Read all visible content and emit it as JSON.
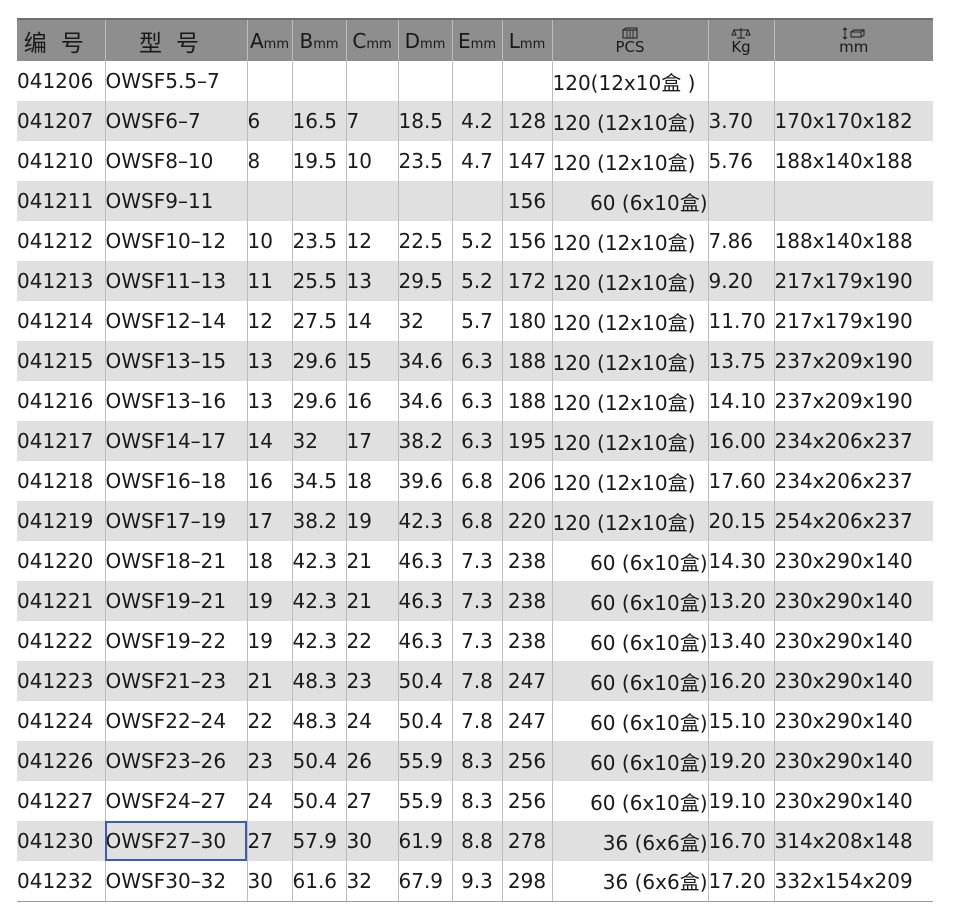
{
  "header": {
    "code": "编号",
    "model": "型号",
    "a": {
      "letter": "A",
      "unit": "mm"
    },
    "b": {
      "letter": "B",
      "unit": "mm"
    },
    "c": {
      "letter": "C",
      "unit": "mm"
    },
    "d": {
      "letter": "D",
      "unit": "mm"
    },
    "e": {
      "letter": "E",
      "unit": "mm"
    },
    "l": {
      "letter": "L",
      "unit": "mm"
    },
    "pcs": "PCS",
    "kg": "Kg",
    "size": "mm",
    "icons": {
      "pcs": "box-stack-icon",
      "kg": "scale-weight-icon",
      "size": "carton-dimension-icon"
    }
  },
  "rows": [
    {
      "code": "041206",
      "model": "OWSF5.5–7",
      "a": "",
      "b": "",
      "c": "",
      "d": "",
      "e": "",
      "l": "",
      "pack": "120(12x10盒 )",
      "kg": "",
      "size": ""
    },
    {
      "code": "041207",
      "model": "OWSF6–7",
      "a": "6",
      "b": "16.5",
      "c": "7",
      "d": "18.5",
      "e": "4.2",
      "l": "128",
      "pack": "120 (12x10盒)",
      "kg": "3.70",
      "size": "170x170x182"
    },
    {
      "code": "041210",
      "model": "OWSF8–10",
      "a": "8",
      "b": "19.5",
      "c": "10",
      "d": "23.5",
      "e": "4.7",
      "l": "147",
      "pack": "120 (12x10盒)",
      "kg": "5.76",
      "size": "188x140x188"
    },
    {
      "code": "041211",
      "model": "OWSF9–11",
      "a": "",
      "b": "",
      "c": "",
      "d": "",
      "e": "",
      "l": "156",
      "pack": "60 (6x10盒)",
      "kg": "",
      "size": ""
    },
    {
      "code": "041212",
      "model": "OWSF10–12",
      "a": "10",
      "b": "23.5",
      "c": "12",
      "d": "22.5",
      "e": "5.2",
      "l": "156",
      "pack": "120 (12x10盒)",
      "kg": "7.86",
      "size": "188x140x188"
    },
    {
      "code": "041213",
      "model": "OWSF11–13",
      "a": "11",
      "b": "25.5",
      "c": "13",
      "d": "29.5",
      "e": "5.2",
      "l": "172",
      "pack": "120 (12x10盒)",
      "kg": "9.20",
      "size": "217x179x190"
    },
    {
      "code": "041214",
      "model": "OWSF12–14",
      "a": "12",
      "b": "27.5",
      "c": "14",
      "d": "32",
      "e": "5.7",
      "l": "180",
      "pack": "120 (12x10盒)",
      "kg": "11.70",
      "size": "217x179x190"
    },
    {
      "code": "041215",
      "model": "OWSF13–15",
      "a": "13",
      "b": "29.6",
      "c": "15",
      "d": "34.6",
      "e": "6.3",
      "l": "188",
      "pack": "120 (12x10盒)",
      "kg": "13.75",
      "size": "237x209x190"
    },
    {
      "code": "041216",
      "model": "OWSF13–16",
      "a": "13",
      "b": "29.6",
      "c": "16",
      "d": "34.6",
      "e": "6.3",
      "l": "188",
      "pack": "120 (12x10盒)",
      "kg": "14.10",
      "size": "237x209x190"
    },
    {
      "code": "041217",
      "model": "OWSF14–17",
      "a": "14",
      "b": "32",
      "c": "17",
      "d": "38.2",
      "e": "6.3",
      "l": "195",
      "pack": "120 (12x10盒)",
      "kg": "16.00",
      "size": "234x206x237"
    },
    {
      "code": "041218",
      "model": "OWSF16–18",
      "a": "16",
      "b": "34.5",
      "c": "18",
      "d": "39.6",
      "e": "6.8",
      "l": "206",
      "pack": "120 (12x10盒)",
      "kg": "17.60",
      "size": "234x206x237"
    },
    {
      "code": "041219",
      "model": "OWSF17–19",
      "a": "17",
      "b": "38.2",
      "c": "19",
      "d": "42.3",
      "e": "6.8",
      "l": "220",
      "pack": "120 (12x10盒)",
      "kg": "20.15",
      "size": "254x206x237"
    },
    {
      "code": "041220",
      "model": "OWSF18–21",
      "a": "18",
      "b": "42.3",
      "c": "21",
      "d": "46.3",
      "e": "7.3",
      "l": "238",
      "pack": "60 (6x10盒)",
      "kg": "14.30",
      "size": "230x290x140"
    },
    {
      "code": "041221",
      "model": "OWSF19–21",
      "a": "19",
      "b": "42.3",
      "c": "21",
      "d": "46.3",
      "e": "7.3",
      "l": "238",
      "pack": "60 (6x10盒)",
      "kg": "13.20",
      "size": "230x290x140"
    },
    {
      "code": "041222",
      "model": "OWSF19–22",
      "a": "19",
      "b": "42.3",
      "c": "22",
      "d": "46.3",
      "e": "7.3",
      "l": "238",
      "pack": "60 (6x10盒)",
      "kg": "13.40",
      "size": "230x290x140"
    },
    {
      "code": "041223",
      "model": "OWSF21–23",
      "a": "21",
      "b": "48.3",
      "c": "23",
      "d": "50.4",
      "e": "7.8",
      "l": "247",
      "pack": "60 (6x10盒)",
      "kg": "16.20",
      "size": "230x290x140"
    },
    {
      "code": "041224",
      "model": "OWSF22–24",
      "a": "22",
      "b": "48.3",
      "c": "24",
      "d": "50.4",
      "e": "7.8",
      "l": "247",
      "pack": "60 (6x10盒)",
      "kg": "15.10",
      "size": "230x290x140"
    },
    {
      "code": "041226",
      "model": "OWSF23–26",
      "a": "23",
      "b": "50.4",
      "c": "26",
      "d": "55.9",
      "e": "8.3",
      "l": "256",
      "pack": "60 (6x10盒)",
      "kg": "19.20",
      "size": "230x290x140"
    },
    {
      "code": "041227",
      "model": "OWSF24–27",
      "a": "24",
      "b": "50.4",
      "c": "27",
      "d": "55.9",
      "e": "8.3",
      "l": "256",
      "pack": "60 (6x10盒)",
      "kg": "19.10",
      "size": "230x290x140"
    },
    {
      "code": "041230",
      "model": "OWSF27–30",
      "a": "27",
      "b": "57.9",
      "c": "30",
      "d": "61.9",
      "e": "8.8",
      "l": "278",
      "pack": "36 (6x6盒)",
      "kg": "16.70",
      "size": "314x208x148"
    },
    {
      "code": "041232",
      "model": "OWSF30–32",
      "a": "30",
      "b": "61.6",
      "c": "32",
      "d": "67.9",
      "e": "9.3",
      "l": "298",
      "pack": "36 (6x6盒)",
      "kg": "17.20",
      "size": "332x154x209"
    }
  ],
  "selected_model": "OWSF27–30",
  "colors": {
    "header_bg": "#8e8e8e",
    "stripe_bg": "#e0e0e0",
    "selection_outline": "#3b5bb5"
  }
}
